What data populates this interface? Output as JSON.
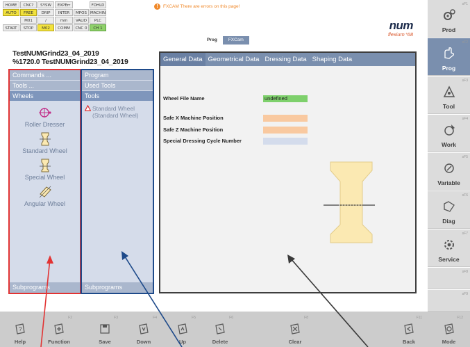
{
  "status": {
    "rows": [
      [
        {
          "t": "HOME",
          "s": "plain"
        },
        {
          "t": "CNC?",
          "s": "plain"
        },
        {
          "t": "SYSW",
          "s": "plain"
        },
        {
          "t": "EXPErr",
          "s": "plain"
        },
        {
          "t": "",
          "s": "blank"
        },
        {
          "t": "FDHLD",
          "s": "plain"
        }
      ],
      [
        {
          "t": "AUTO",
          "s": "on"
        },
        {
          "t": "FREE",
          "s": "on"
        },
        {
          "t": "DRIP",
          "s": "plain"
        },
        {
          "t": "INTER",
          "s": "plain"
        },
        {
          "t": "MPOS",
          "s": "plain"
        },
        {
          "t": "MACHINY",
          "s": "plain"
        }
      ],
      [
        {
          "t": "",
          "s": "blank"
        },
        {
          "t": "M01",
          "s": "plain"
        },
        {
          "t": "/",
          "s": "plain"
        },
        {
          "t": "mm",
          "s": "plain"
        },
        {
          "t": "VALID",
          "s": "plain"
        },
        {
          "t": "PLC",
          "s": "plain"
        }
      ],
      [
        {
          "t": "START",
          "s": "plain"
        },
        {
          "t": "STOP",
          "s": "plain"
        },
        {
          "t": "M02",
          "s": "on"
        },
        {
          "t": "COMM",
          "s": "plain"
        },
        {
          "t": "CNC 0",
          "s": "plain"
        },
        {
          "t": "CH 1",
          "s": "green"
        }
      ]
    ]
  },
  "warning": {
    "text": "FXCAM There are errors on this page!"
  },
  "logo": {
    "main": "num",
    "sub": "flexium⁺68"
  },
  "top_tabs": [
    {
      "label": "Prog"
    },
    {
      "label": "FXCam"
    }
  ],
  "title": {
    "line1": "TestNUMGrind23_04_2019",
    "line2": "%1720.0 TestNUMGrind23_04_2019"
  },
  "left_column": {
    "commands": "Commands ...",
    "tools": "Tools ...",
    "wheels": "Wheels",
    "items": [
      {
        "label": "Roller Dresser",
        "icon": "roller-dresser-icon"
      },
      {
        "label": "Standard Wheel",
        "icon": "standard-wheel-icon"
      },
      {
        "label": "Special Wheel",
        "icon": "special-wheel-icon"
      },
      {
        "label": "Angular Wheel",
        "icon": "angular-wheel-icon"
      }
    ],
    "footer": "Subprograms"
  },
  "middle_column": {
    "program": "Program",
    "used_tools": "Used Tools",
    "tools": "Tools",
    "entry_line1": "Standard Wheel",
    "entry_line2": "(Standard Wheel)",
    "footer": "Subprograms"
  },
  "main": {
    "tabs": [
      {
        "label": "General Data"
      },
      {
        "label": "Geometrical Data"
      },
      {
        "label": "Dressing Data"
      },
      {
        "label": "Shaping Data"
      }
    ],
    "fields": {
      "wheel_file_name": {
        "label": "Wheel File Name",
        "value": "undefined"
      },
      "safe_x": {
        "label": "Safe X Machine Position",
        "value": ""
      },
      "safe_z": {
        "label": "Safe Z Machine Position",
        "value": ""
      },
      "special_cycle": {
        "label": "Special Dressing Cycle Number",
        "value": ""
      }
    }
  },
  "right_nav": [
    {
      "label": "Prod",
      "fkey": "sF1",
      "icon": "gears-icon"
    },
    {
      "label": "Prog",
      "fkey": "sF2",
      "icon": "program-hand-icon"
    },
    {
      "label": "Tool",
      "fkey": "sF3",
      "icon": "tool-icon"
    },
    {
      "label": "Work",
      "fkey": "sF4",
      "icon": "work-icon"
    },
    {
      "label": "Variable",
      "fkey": "sF5",
      "icon": "variable-icon"
    },
    {
      "label": "Diag",
      "fkey": "sF6",
      "icon": "diag-icon"
    },
    {
      "label": "Service",
      "fkey": "sF7",
      "icon": "service-icon"
    },
    {
      "label": "",
      "fkey": "sF8",
      "icon": ""
    },
    {
      "label": "",
      "fkey": "sF9",
      "icon": ""
    }
  ],
  "bottom_bar": [
    {
      "label": "Help",
      "fkey": "",
      "icon": "help-icon"
    },
    {
      "label": "Function",
      "fkey": "F2",
      "icon": "function-icon"
    },
    {
      "label": "Save",
      "fkey": "F3",
      "icon": "save-icon"
    },
    {
      "label": "Down",
      "fkey": "F4",
      "icon": "down-icon"
    },
    {
      "label": "Up",
      "fkey": "F5",
      "icon": "up-icon"
    },
    {
      "label": "Delete",
      "fkey": "F6",
      "icon": "delete-icon"
    },
    {
      "label": "",
      "fkey": "",
      "icon": ""
    },
    {
      "label": "Clear",
      "fkey": "F8",
      "icon": "clear-icon"
    },
    {
      "label": "",
      "fkey": "",
      "icon": ""
    },
    {
      "label": "",
      "fkey": "",
      "icon": ""
    },
    {
      "label": "Back",
      "fkey": "F11",
      "icon": "back-icon"
    },
    {
      "label": "Mode",
      "fkey": "F12",
      "icon": "mode-icon"
    }
  ],
  "colors": {
    "accent": "#7a8fae",
    "column_bg": "#d5dcea",
    "red_frame": "#e23333",
    "blue_frame": "#1e4a8a",
    "dark_frame": "#3e3e3e",
    "field_green": "#7ed06c",
    "field_orange": "#f9c9a0",
    "wheel_fill": "#fbe9b2"
  }
}
